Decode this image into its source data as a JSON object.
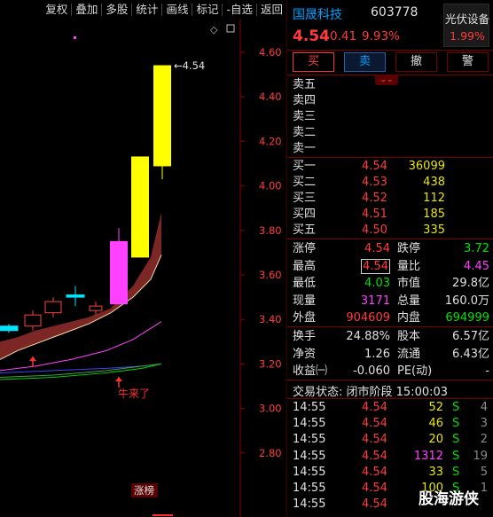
{
  "toolbar": [
    "复权",
    "叠加",
    "多股",
    "统计",
    "画线",
    "标记",
    "-自选",
    "返回"
  ],
  "chart": {
    "y_ticks": [
      "4.60",
      "4.40",
      "4.20",
      "4.00",
      "3.80",
      "3.60",
      "3.40",
      "3.20",
      "3.00",
      "2.80"
    ],
    "last_price_label": "4.54",
    "annotation": "牛来了",
    "limit_up_tag": "涨榜",
    "colors": {
      "up_limit": "#ffff00",
      "up": "#ff40ff",
      "doji": "#00e5ff",
      "band": "#8b2a2a",
      "ma_white": "#ffffff",
      "ma_magenta": "#ff40ff",
      "ma_blue": "#4040ff",
      "ma_green": "#00d000",
      "grid": "#8a0000",
      "axis_text": "#ff3b3b"
    }
  },
  "chart_data": {
    "type": "candlestick",
    "ylim": [
      2.7,
      4.66
    ],
    "candles": [
      {
        "open": 3.35,
        "close": 3.37,
        "high": 3.38,
        "low": 3.34
      },
      {
        "open": 3.37,
        "close": 3.42,
        "high": 3.44,
        "low": 3.35
      },
      {
        "open": 3.43,
        "close": 3.48,
        "high": 3.5,
        "low": 3.41
      },
      {
        "open": 3.5,
        "close": 3.51,
        "high": 3.55,
        "low": 3.46
      },
      {
        "open": 3.44,
        "close": 3.46,
        "high": 3.48,
        "low": 3.42
      },
      {
        "open": 3.47,
        "close": 3.75,
        "high": 3.81,
        "low": 3.47
      },
      {
        "open": 3.68,
        "close": 4.13,
        "high": 4.13,
        "low": 3.68
      },
      {
        "open": 4.09,
        "close": 4.54,
        "high": 4.54,
        "low": 4.03
      }
    ]
  },
  "quote": {
    "name": "国晟科技",
    "code": "603778",
    "price": "4.54",
    "change": "0.41",
    "pct": "9.93%",
    "sector_name": "光伏设备",
    "sector_pct": "1.99%",
    "buttons": {
      "buy": "买",
      "sell": "卖",
      "cancel": "撤",
      "alert": "警"
    },
    "collapse": "⌄⌄",
    "asks": [
      {
        "label": "卖五",
        "price": "",
        "vol": ""
      },
      {
        "label": "卖四",
        "price": "",
        "vol": ""
      },
      {
        "label": "卖三",
        "price": "",
        "vol": ""
      },
      {
        "label": "卖二",
        "price": "",
        "vol": ""
      },
      {
        "label": "卖一",
        "price": "",
        "vol": ""
      }
    ],
    "bids": [
      {
        "label": "买一",
        "price": "4.54",
        "vol": "36099"
      },
      {
        "label": "买二",
        "price": "4.53",
        "vol": "438"
      },
      {
        "label": "买三",
        "price": "4.52",
        "vol": "112"
      },
      {
        "label": "买四",
        "price": "4.51",
        "vol": "185"
      },
      {
        "label": "买五",
        "price": "4.50",
        "vol": "335"
      }
    ],
    "stats1": [
      {
        "l1": "涨停",
        "v1": "4.54",
        "c1": "red",
        "l2": "跌停",
        "v2": "3.72",
        "c2": "green"
      },
      {
        "l1": "最高",
        "v1": "4.54",
        "c1": "red boxed",
        "l2": "量比",
        "v2": "4.45",
        "c2": "magenta"
      },
      {
        "l1": "最低",
        "v1": "4.03",
        "c1": "green",
        "l2": "市值",
        "v2": "29.8亿",
        "c2": "white"
      },
      {
        "l1": "现量",
        "v1": "3171",
        "c1": "magenta",
        "l2": "总量",
        "v2": "160.0万",
        "c2": "white"
      },
      {
        "l1": "外盘",
        "v1": "904609",
        "c1": "red",
        "l2": "内盘",
        "v2": "694999",
        "c2": "green"
      }
    ],
    "stats2": [
      {
        "l1": "换手",
        "v1": "24.88%",
        "c1": "white",
        "l2": "股本",
        "v2": "6.57亿",
        "c2": "white"
      },
      {
        "l1": "净资",
        "v1": "1.26",
        "c1": "white",
        "l2": "流通",
        "v2": "6.43亿",
        "c2": "white"
      },
      {
        "l1": "收益㈠",
        "v1": "-0.060",
        "c1": "white",
        "l2": "PE(动)",
        "v2": "-",
        "c2": "white"
      }
    ],
    "trade_status": "交易状态: 闭市阶段 15:00:03",
    "ticks": [
      {
        "time": "14:55",
        "price": "4.54",
        "vol": "52",
        "vc": "#e6e600",
        "side": "S",
        "cnt": "4"
      },
      {
        "time": "14:55",
        "price": "4.54",
        "vol": "46",
        "vc": "#e6e600",
        "side": "S",
        "cnt": "3"
      },
      {
        "time": "14:55",
        "price": "4.54",
        "vol": "20",
        "vc": "#e6e600",
        "side": "S",
        "cnt": "2"
      },
      {
        "time": "14:55",
        "price": "4.54",
        "vol": "1312",
        "vc": "#ff40ff",
        "side": "S",
        "cnt": "19"
      },
      {
        "time": "14:55",
        "price": "4.54",
        "vol": "33",
        "vc": "#e6e600",
        "side": "S",
        "cnt": "5"
      },
      {
        "time": "14:55",
        "price": "4.54",
        "vol": "100",
        "vc": "#e6e600",
        "side": "S",
        "cnt": "1"
      },
      {
        "time": "14:55",
        "price": "4.54",
        "vol": "",
        "vc": "#e6e600",
        "side": "",
        "cnt": ""
      }
    ],
    "watermark": "股海游侠"
  }
}
